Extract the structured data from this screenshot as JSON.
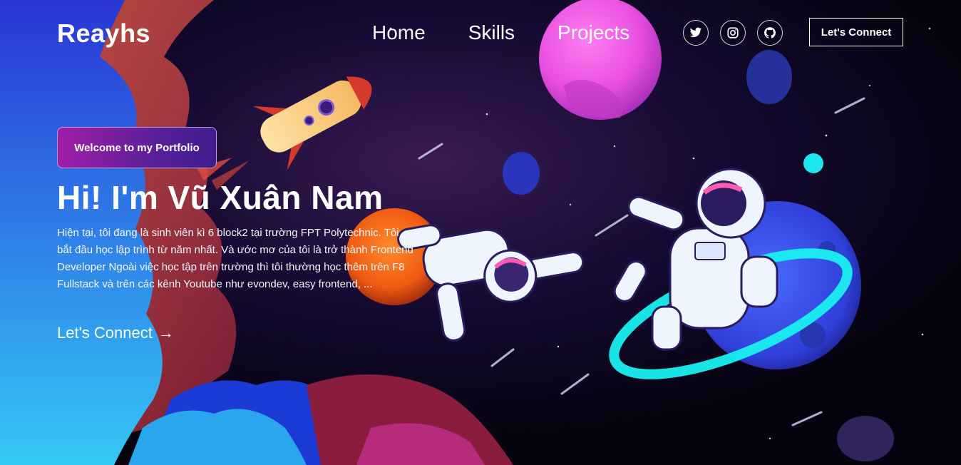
{
  "brand": "Reayhs",
  "nav": {
    "links": [
      "Home",
      "Skills",
      "Projects"
    ],
    "social": [
      {
        "icon": "twitter-icon"
      },
      {
        "icon": "instagram-icon"
      },
      {
        "icon": "github-icon"
      }
    ],
    "connect_label": "Let's Connect"
  },
  "hero": {
    "tagline": "Welcome to my Portfolio",
    "title": "Hi! I'm Vũ Xuân Nam",
    "description": "Hiện tại, tôi đang là sinh viên kì 6 block2 tại trường FPT Polytechnic. Tôi bắt đầu học lập trình từ năm nhất. Và ước mơ của tôi là trở thành Frontend Developer Ngoài việc học tập trên trường thì tôi thường học thêm trên F8 Fullstack và trên các kênh Youtube như evondev, easy frontend, ...",
    "cta_label": "Let's Connect",
    "cta_arrow": "→"
  },
  "colors": {
    "tagline_start": "#a11fa8",
    "tagline_end": "#3e1e8f",
    "space_bg": "#06041a"
  }
}
